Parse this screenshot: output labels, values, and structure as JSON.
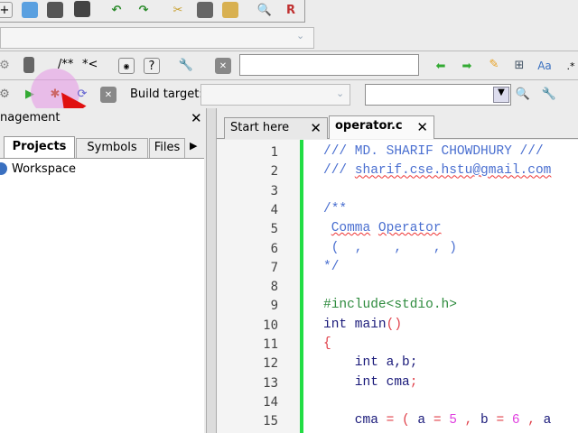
{
  "toolbar_main": {
    "icons": [
      "new-file-icon",
      "open-icon",
      "save-icon",
      "save-all-icon",
      "undo-icon",
      "redo-icon",
      "cut-icon",
      "copy-icon",
      "paste-icon",
      "find-icon",
      "replace-icon"
    ]
  },
  "toolbar_code": {
    "doxygen_block": "/**",
    "doxygen_line": "*<",
    "search_value": ""
  },
  "build": {
    "target_label": "Build target:",
    "target_value": "",
    "search_value": ""
  },
  "management": {
    "title": "nagement",
    "tabs": [
      "Projects",
      "Symbols",
      "Files"
    ],
    "active_tab": "Projects",
    "tree": [
      "Workspace"
    ]
  },
  "editor": {
    "tabs": [
      {
        "label": "Start here",
        "active": false
      },
      {
        "label": "operator.c",
        "active": true
      }
    ],
    "line_numbers": [
      "1",
      "2",
      "3",
      "4",
      "5",
      "6",
      "7",
      "8",
      "9",
      "10",
      "11",
      "12",
      "13",
      "14",
      "15"
    ],
    "lines": [
      "/// MD. SHARIF CHOWDHURY ///",
      "/// sharif.cse.hstu@gmail.com",
      "",
      "/**",
      " Comma Operator",
      " (  ,    ,    , )",
      "*/",
      "",
      "#include<stdio.h>",
      "int main()",
      "{",
      "    int a,b;",
      "    int cma;",
      "",
      "    cma = ( a = 5 , b = 6 , a"
    ]
  },
  "colors": {
    "comment": "#4a6fd0",
    "preprocessor": "#2e8b3e",
    "operator": "#e0404a",
    "number": "#e040e0",
    "keyword": "#1a1a7a",
    "changebar": "#22dd44"
  }
}
